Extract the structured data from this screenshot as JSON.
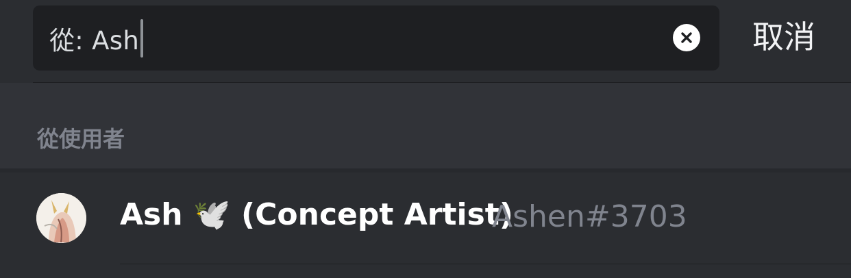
{
  "search": {
    "value": "從: Ash",
    "clear_icon": "close-circle-icon",
    "cancel_label": "取消"
  },
  "section": {
    "title": "從使用者"
  },
  "results": [
    {
      "display_name": "Ash 🕊️ (Concept Artist)",
      "tag": "Ashen#3703",
      "avatar_icon": "user-avatar"
    }
  ],
  "colors": {
    "background": "#2b2d31",
    "search_box": "#1e1f22",
    "section_bg": "#313338",
    "muted_text": "#80848e",
    "primary_text": "#ffffff"
  }
}
